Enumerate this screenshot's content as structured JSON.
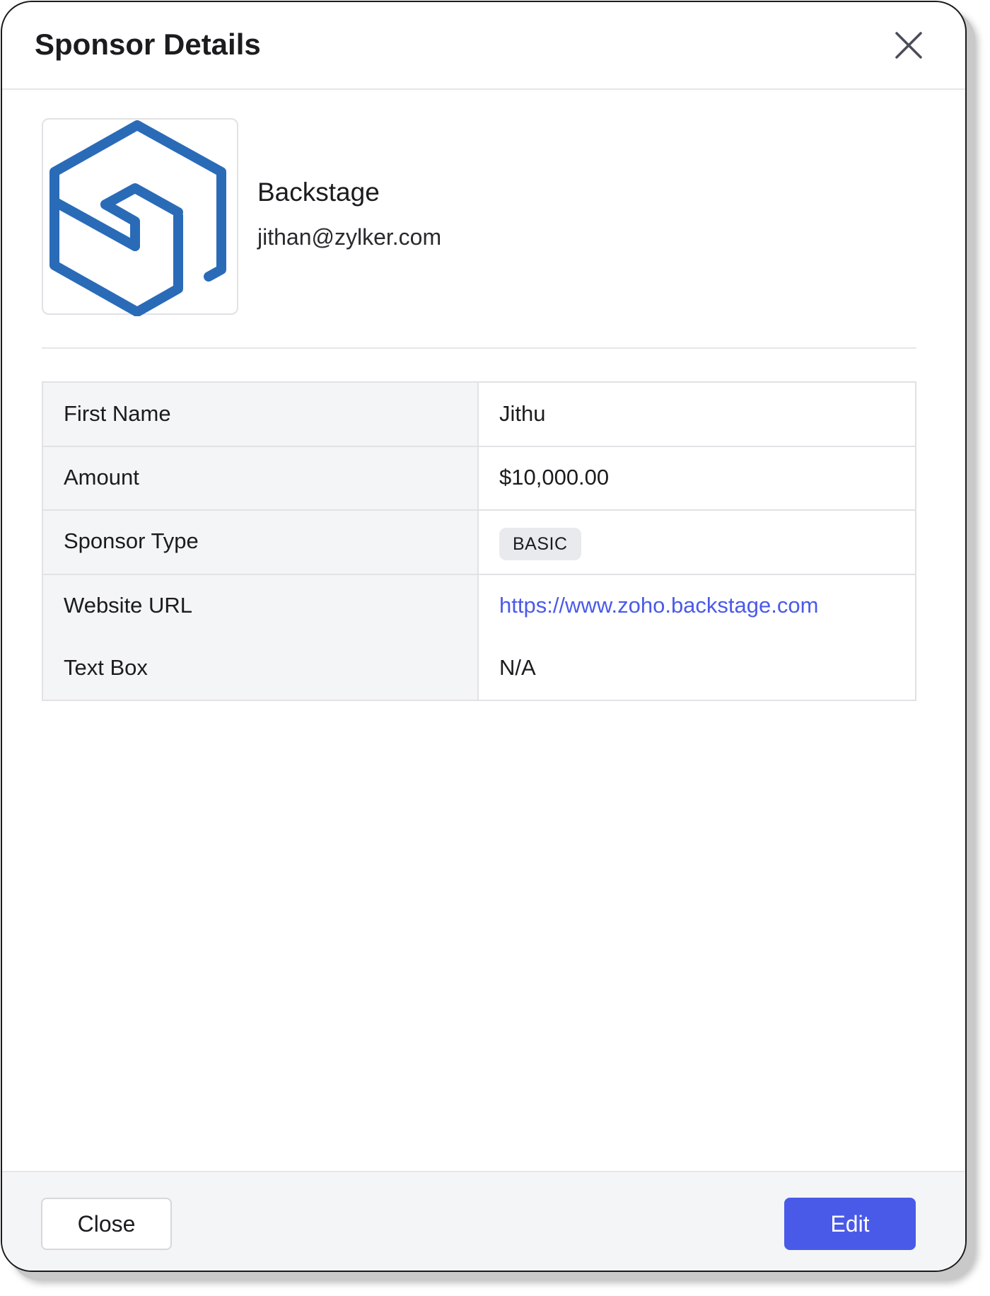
{
  "modal": {
    "title": "Sponsor Details"
  },
  "sponsor": {
    "name": "Backstage",
    "email": "jithan@zylker.com",
    "logo_icon": "hexagon-box-logo",
    "logo_color": "#2a6bb8"
  },
  "details": {
    "rows": [
      {
        "label": "First Name",
        "value": "Jithu"
      },
      {
        "label": "Amount",
        "value": "$10,000.00"
      },
      {
        "label": "Sponsor Type",
        "value": "BASIC"
      },
      {
        "label": "Website URL",
        "value": "https://www.zoho.backstage.com"
      },
      {
        "label": "Text Box",
        "value": "N/A"
      }
    ]
  },
  "footer": {
    "close_label": "Close",
    "edit_label": "Edit"
  },
  "colors": {
    "accent": "#4a5ae8",
    "link": "#4a5ae8",
    "badge_bg": "#e9eaed"
  }
}
